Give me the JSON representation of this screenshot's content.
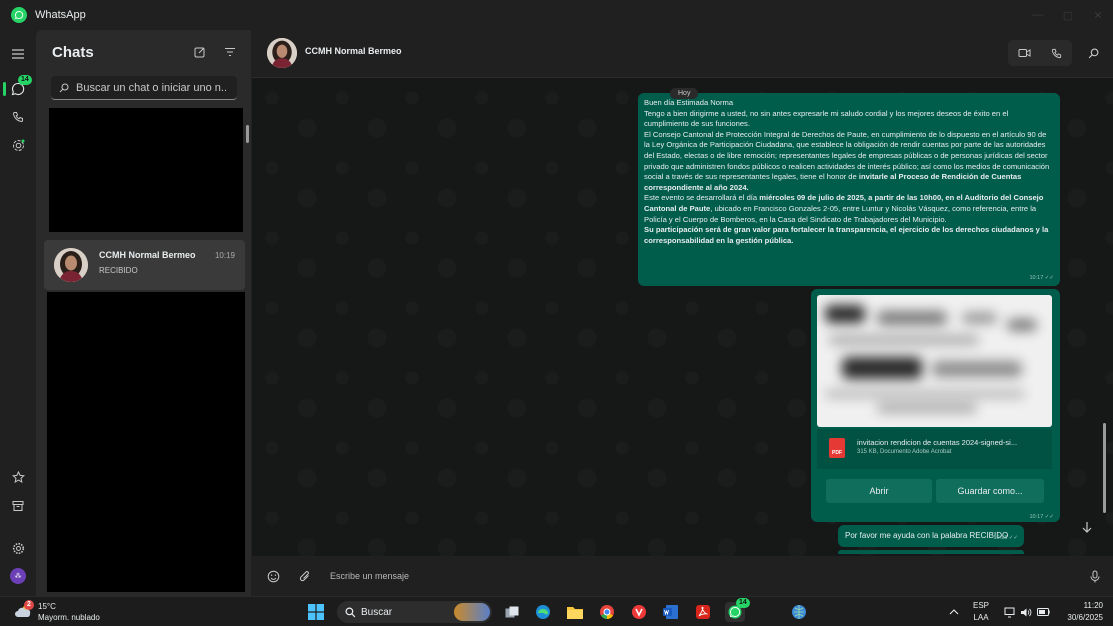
{
  "window": {
    "title": "WhatsApp"
  },
  "rail": {
    "chats_badge": "14"
  },
  "chat_list": {
    "title": "Chats",
    "search_placeholder": "Buscar un chat o iniciar uno n...",
    "items": [
      {
        "name": "CCMH Normal Bermeo",
        "time": "10:19",
        "preview": "RECIBIDO"
      }
    ]
  },
  "conversation": {
    "contact_name": "CCMH Normal Bermeo",
    "day_label": "Hoy",
    "message1": {
      "l1": "Buen día Estimada Norma",
      "l2": "Tengo a bien dirigirme a usted, no sin antes expresarle mi saludo cordial y los mejores deseos de éxito en el cumplimiento de sus funciones.",
      "l3a": "El Consejo Cantonal de Protección Integral de Derechos de Paute, en cumplimiento de lo dispuesto en el artículo 90 de la Ley Orgánica de Participación Ciudadana, que establece la obligación de rendir cuentas por parte de las autoridades del Estado, electas o de libre remoción; representantes legales de empresas públicas o de personas jurídicas del sector privado que administren fondos públicos o realicen actividades de interés público; así como los medios de comunicación social a través de sus representantes legales, tiene el honor de ",
      "l3b": "invitarle al Proceso de Rendición de Cuentas correspondiente al año 2024.",
      "l4a": "Este evento se desarrollará el día ",
      "l4b": "miércoles 09 de julio de 2025, a partir de las 10h00, en el Auditorio del Consejo Cantonal de Paute",
      "l4c": ", ubicado en Francisco Gonzales 2-05, entre Luntur y Nicolás Vásquez, como referencia, entre la Policía y el Cuerpo de Bomberos, en la Casa del Sindicato de Trabajadores del Municipio.",
      "l5": "Su participación será de gran valor para fortalecer la transparencia, el ejercicio de los derechos ciudadanos y la corresponsabilidad en la gestión pública.",
      "time": "10:17"
    },
    "document": {
      "filename": "invitacion rendicion de cuentas 2024-signed-si...",
      "meta": "315 KB, Documento Adobe Acrobat",
      "icon_label": "PDF",
      "open_label": "Abrir",
      "save_label": "Guardar como...",
      "time": "10:17"
    },
    "message3": {
      "text": "Por favor me ayuda con la palabra RECIBIDO",
      "time": "10:18"
    },
    "composer_placeholder": "Escribe un mensaje"
  },
  "taskbar": {
    "weather_temp": "15°C",
    "weather_cond": "Mayorm. nublado",
    "weather_badge": "2",
    "search_label": "Buscar",
    "whatsapp_badge": "14",
    "lang_top": "ESP",
    "lang_bottom": "LAA",
    "time": "11:20",
    "date": "30/6/2025"
  },
  "colors": {
    "accent": "#25d366",
    "outgoing_bubble": "#005c4b",
    "background": "#161717"
  }
}
